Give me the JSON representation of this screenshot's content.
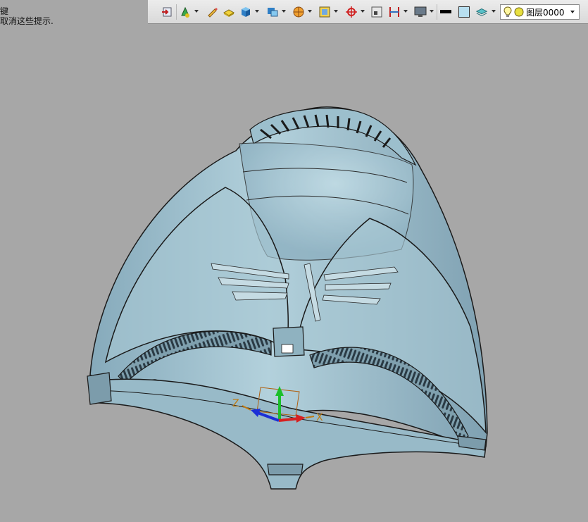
{
  "hint": {
    "line1": "键",
    "line2": "取消这些提示."
  },
  "toolbar": {
    "icons": [
      "import-icon",
      "paint-icon",
      "pencil-icon",
      "eraser-block-icon",
      "solid-cube-icon",
      "render-mode-icon",
      "sphere-icon",
      "frame-icon",
      "origin-icon",
      "view-box-icon",
      "section-icon",
      "display-icon",
      "line-color-icon",
      "fill-color-icon",
      "layer-stack-icon"
    ],
    "layer_name": "图层0000"
  },
  "axes": {
    "x_label": "X",
    "z_label": "Z"
  },
  "colors": {
    "background": "#a7a7a7",
    "model_fill": "#9fc2cf",
    "model_edge": "#1a1a1a",
    "axis_x": "#d62020",
    "axis_y": "#1bbf2a",
    "axis_z": "#1c2fd6",
    "axis_label": "#c07a10"
  }
}
